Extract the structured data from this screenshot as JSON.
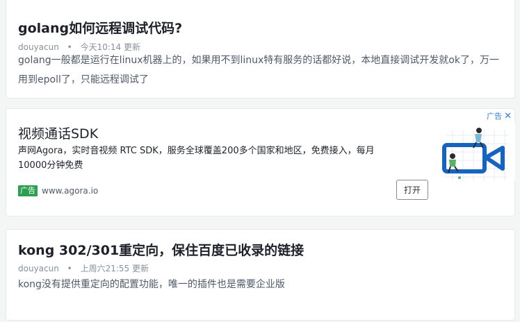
{
  "articles": [
    {
      "title": "golang如何远程调试代码?",
      "author": "douyacun",
      "separator": "•",
      "time": "今天10:14 更新",
      "excerpt": "golang一般都是运行在linux机器上的，如果用不到linux特有服务的话都好说，本地直接调试开发就ok了，万一用到epoll了，只能远程调试了"
    },
    {
      "title": "kong 302/301重定向，保住百度已收录的链接",
      "author": "douyacun",
      "separator": "•",
      "time": "上周六21:55 更新",
      "excerpt": "kong没有提供重定向的配置功能，唯一的插件也是需要企业版"
    }
  ],
  "ad": {
    "corner_label": "广告",
    "close": "✕",
    "title": "视频通话SDK",
    "description": "声网Agora，实时音视频 RTC SDK，服务全球覆盖200多个国家和地区，免费接入，每月10000分钟免费",
    "tag": "广告",
    "source": "www.agora.io",
    "button": "打开",
    "image_icon": "video-camera-illustration",
    "accent_color": "#1565c0"
  }
}
